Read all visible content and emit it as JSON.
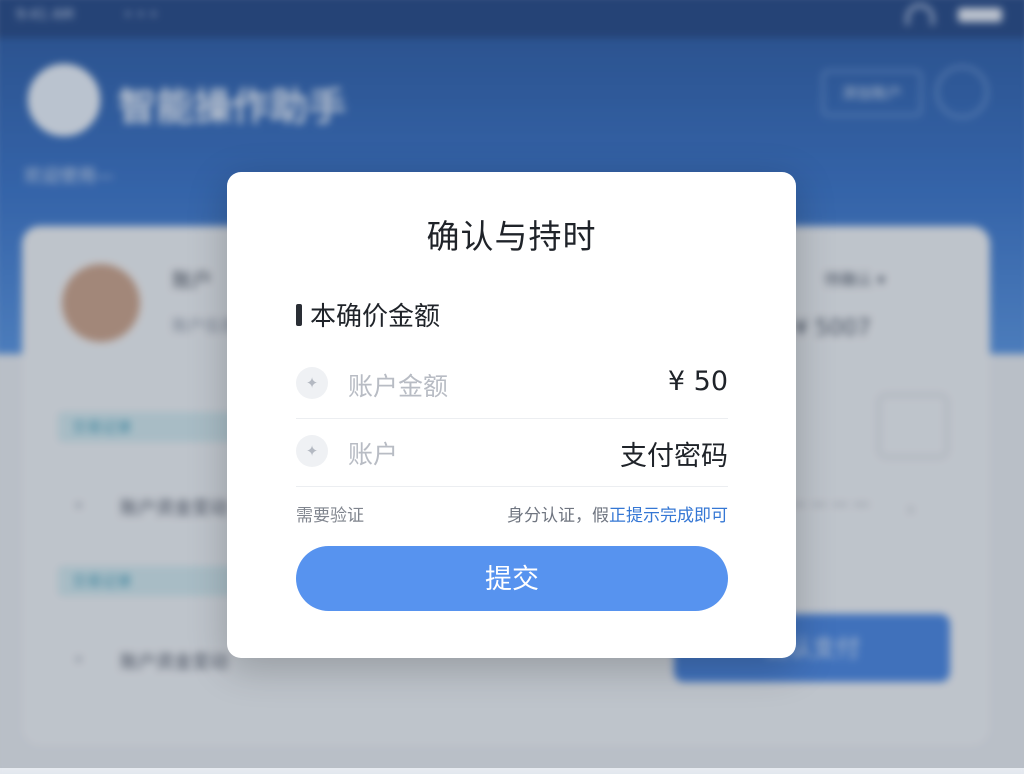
{
  "background": {
    "statusbar": {
      "time": "9:41 AM",
      "signal": "• • •"
    },
    "header": {
      "title": "智能操作助手",
      "subtitle": "欢迎使用—",
      "top_button": "添加账户"
    },
    "user": {
      "name": "账户",
      "sub": "账户信息",
      "right_label": "待确认 ▾",
      "right_value": "¥ 5007"
    },
    "tags": [
      "交易记录",
      "交易记录"
    ],
    "rows": [
      "账户资金变动",
      "账户资金变动"
    ],
    "row_right": "— — — —",
    "row_bullet": "•",
    "row_arrow": "›",
    "blue_button": "确认支付"
  },
  "modal": {
    "title": "确认与持时",
    "section_heading": "本确价金额",
    "fields": [
      {
        "icon": "wallet-icon",
        "icon_glyph": "✦",
        "label": "账户金额",
        "value": "¥ 50"
      },
      {
        "icon": "lock-icon",
        "icon_glyph": "✦",
        "label": "账户",
        "value": "支付密码"
      }
    ],
    "hint_left": "需要验证",
    "hint_right_prefix": "身分认证，假",
    "hint_right_link": "正提示完成即可",
    "submit_label": "提交"
  },
  "colors": {
    "accent": "#5793ef",
    "link": "#3577d4",
    "header_blue": "#2f6cc6"
  }
}
